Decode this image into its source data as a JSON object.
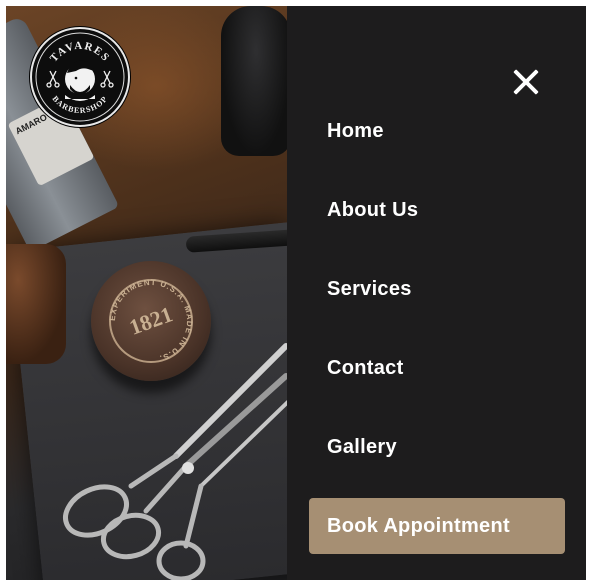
{
  "logo": {
    "brand": "TAVARES",
    "subtitle": "BARBERSHOP"
  },
  "photo": {
    "tube_label": "AMARO",
    "tin_text": "1821",
    "tin_ring_text": "EXPERIMENT U.S.A. MADE IN U.S."
  },
  "menu": {
    "close_icon": "close-icon",
    "items": [
      {
        "label": "Home"
      },
      {
        "label": "About Us"
      },
      {
        "label": "Services"
      },
      {
        "label": "Contact"
      },
      {
        "label": "Gallery"
      }
    ],
    "cta_label": "Book Appointment"
  },
  "colors": {
    "menu_background": "#1d1c1d",
    "menu_text": "#ffffff",
    "cta_background": "#a68f73"
  }
}
